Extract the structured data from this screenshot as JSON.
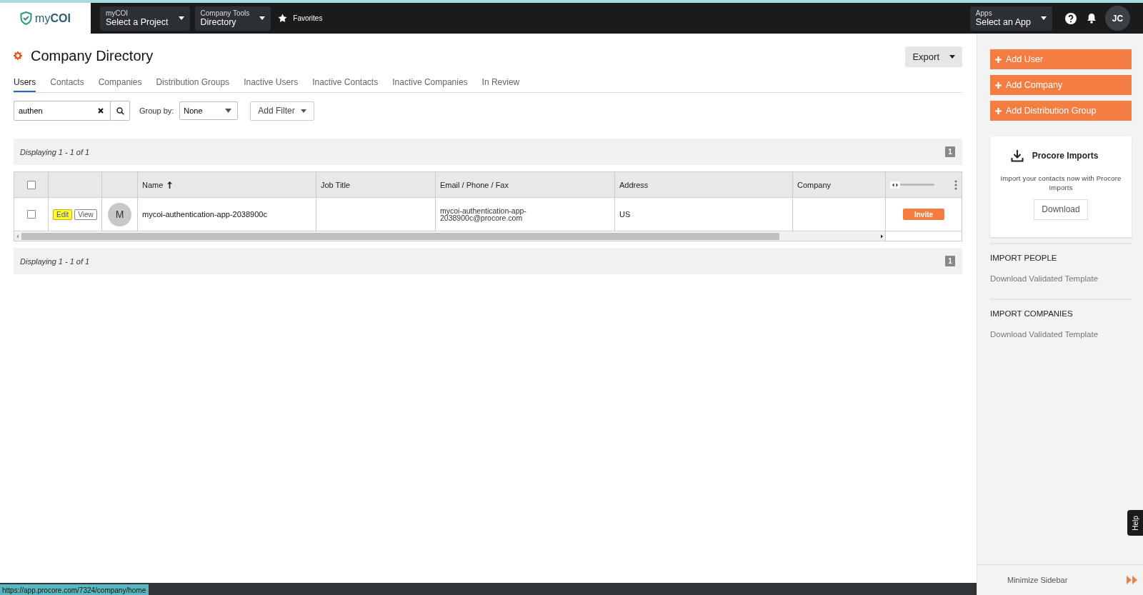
{
  "header": {
    "logo": "myCOI",
    "menus": [
      {
        "label": "myCOI",
        "value": "Select a Project"
      },
      {
        "label": "Company Tools",
        "value": "Directory"
      }
    ],
    "favorites": "Favorites",
    "apps_menu": {
      "label": "Apps",
      "value": "Select an App"
    },
    "avatar": "JC"
  },
  "page": {
    "title": "Company Directory",
    "export": "Export"
  },
  "tabs": [
    {
      "label": "Users",
      "selected": true
    },
    {
      "label": "Contacts",
      "selected": false
    },
    {
      "label": "Companies",
      "selected": false
    },
    {
      "label": "Distribution Groups",
      "selected": false
    },
    {
      "label": "Inactive Users",
      "selected": false
    },
    {
      "label": "Inactive Contacts",
      "selected": false
    },
    {
      "label": "Inactive Companies",
      "selected": false
    },
    {
      "label": "In Review",
      "selected": false
    }
  ],
  "search": {
    "value": "authen"
  },
  "group_by": {
    "label": "Group by:",
    "value": "None"
  },
  "add_filter": "Add Filter",
  "pager_top": {
    "text": "Displaying 1 - 1 of 1",
    "page": "1"
  },
  "table": {
    "select_all_checked": false,
    "column_slider": {
      "level": 0
    },
    "columns": [
      {
        "label": "Name",
        "sorted": true
      },
      {
        "label": "Job Title",
        "sorted": false
      },
      {
        "label": "Email / Phone / Fax",
        "sorted": false
      },
      {
        "label": "Address",
        "sorted": false
      },
      {
        "label": "Company",
        "sorted": false
      }
    ],
    "rows": [
      {
        "checked": false,
        "edit": "Edit",
        "edit_highlighted": true,
        "view": "View",
        "avatar": "M",
        "name": "mycoi-authentication-app-2038900c",
        "email": "mycoi-authentication-app-2038900c@procore.com",
        "address": "US",
        "invite": "Invite"
      }
    ]
  },
  "pager_bottom": {
    "text": "Displaying 1 - 1 of 1",
    "page": "1"
  },
  "sidebar": {
    "buttons": [
      "Add User",
      "Add Company",
      "Add Distribution Group"
    ],
    "imports_card": {
      "title": "Procore Imports",
      "text": "Import your contacts now with Procore Imports",
      "button": "Download"
    },
    "sections": [
      {
        "heading": "IMPORT PEOPLE",
        "link": "Download Validated Template"
      },
      {
        "heading": "IMPORT COMPANIES",
        "link": "Download Validated Template"
      }
    ],
    "minimize": "Minimize Sidebar",
    "help": "Help"
  },
  "status_url": "https://app.procore.com/7324/company/home"
}
